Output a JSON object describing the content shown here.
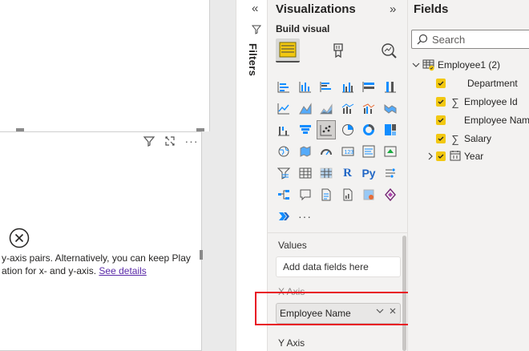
{
  "canvas": {
    "error_line1": "y-axis pairs. Alternatively, you can keep Play",
    "error_line2": "ation for x- and y-axis.",
    "see_details": "See details",
    "header_icons": [
      "filter-icon",
      "focus-mode-icon",
      "more-options-icon"
    ]
  },
  "filters": {
    "label": "Filters"
  },
  "visualizations": {
    "title": "Visualizations",
    "build_visual_label": "Build visual",
    "build_tabs": [
      "build-visual-icon",
      "format-visual-icon",
      "analytics-icon"
    ],
    "gallery_icons": [
      "stacked-bar",
      "stacked-column",
      "clustered-bar",
      "clustered-column",
      "100-stacked-bar",
      "100-stacked-column",
      "line",
      "area",
      "stacked-area",
      "line-and-column",
      "line-clustered-column",
      "ribbon",
      "waterfall",
      "funnel",
      "scatter",
      "pie",
      "donut",
      "treemap",
      "map",
      "filled-map",
      "gauge",
      "card",
      "multi-row-card",
      "kpi",
      "slicer",
      "table",
      "matrix",
      "r-visual",
      "python-visual",
      "key-influencers",
      "decomposition-tree",
      "qa",
      "smart-narrative",
      "paginated-report",
      "power-apps",
      "power-automate",
      "power-automate-flow",
      "more-visuals"
    ],
    "wells": {
      "values_label": "Values",
      "values_placeholder": "Add data fields here",
      "x_axis_label": "X Axis",
      "x_axis_field": "Employee Name",
      "y_axis_label": "Y Axis"
    }
  },
  "fields": {
    "title": "Fields",
    "search_placeholder": "Search",
    "table_name": "Employee1 (2)",
    "items": [
      {
        "name": "Department",
        "type": "text",
        "checked": true
      },
      {
        "name": "Employee Id",
        "type": "sigma",
        "checked": true
      },
      {
        "name": "Employee Name",
        "type": "text",
        "checked": true
      },
      {
        "name": "Salary",
        "type": "sigma",
        "checked": true
      },
      {
        "name": "Year",
        "type": "calendar",
        "checked": true
      }
    ]
  },
  "colors": {
    "accent_yellow": "#f2c811",
    "highlight_red": "#e81123",
    "link_purple": "#5a2aa8"
  }
}
